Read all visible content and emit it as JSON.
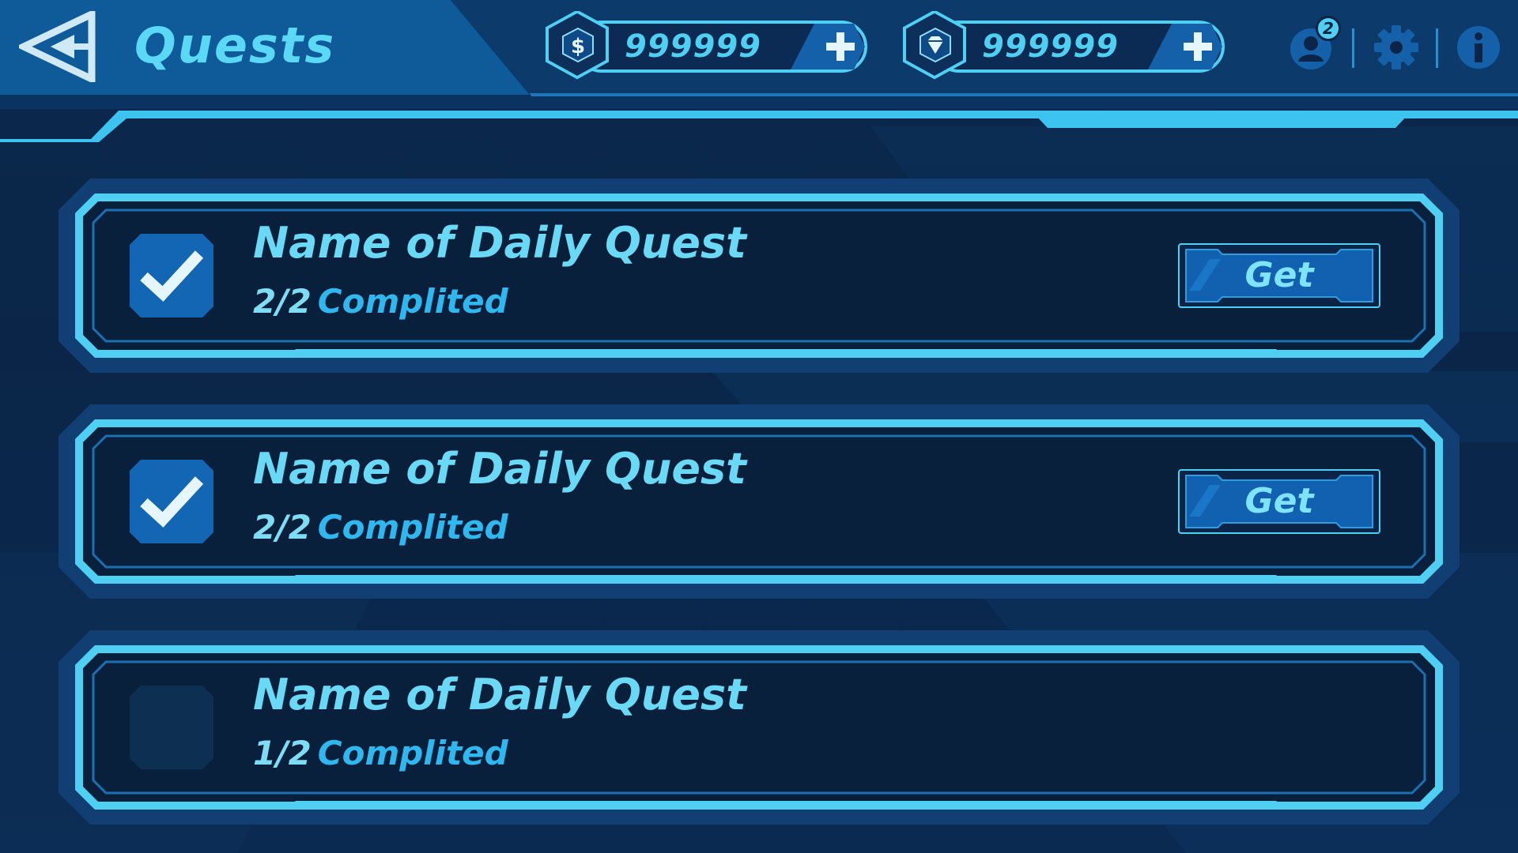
{
  "header": {
    "title": "Quests",
    "back_icon": "back-arrow-icon"
  },
  "currencies": [
    {
      "icon": "dollar-coin-icon",
      "value": "999999",
      "add_icon": "plus-icon"
    },
    {
      "icon": "diamond-gem-icon",
      "value": "999999",
      "add_icon": "plus-icon"
    }
  ],
  "top_icons": {
    "profile": {
      "icon": "profile-icon",
      "badge": "2"
    },
    "settings": {
      "icon": "gear-icon"
    },
    "info": {
      "icon": "info-icon"
    }
  },
  "quests": [
    {
      "name": "Name of Daily Quest",
      "count": "2/2",
      "status": "Complited",
      "completed": true,
      "button_label": "Get"
    },
    {
      "name": "Name of Daily Quest",
      "count": "2/2",
      "status": "Complited",
      "completed": true,
      "button_label": "Get"
    },
    {
      "name": "Name of Daily Quest",
      "count": "1/2",
      "status": "Complited",
      "completed": false,
      "button_label": ""
    }
  ],
  "colors": {
    "accent": "#5ad8f5",
    "panel": "#08203b",
    "border": "#4fd0f3",
    "button": "#1161b0"
  }
}
